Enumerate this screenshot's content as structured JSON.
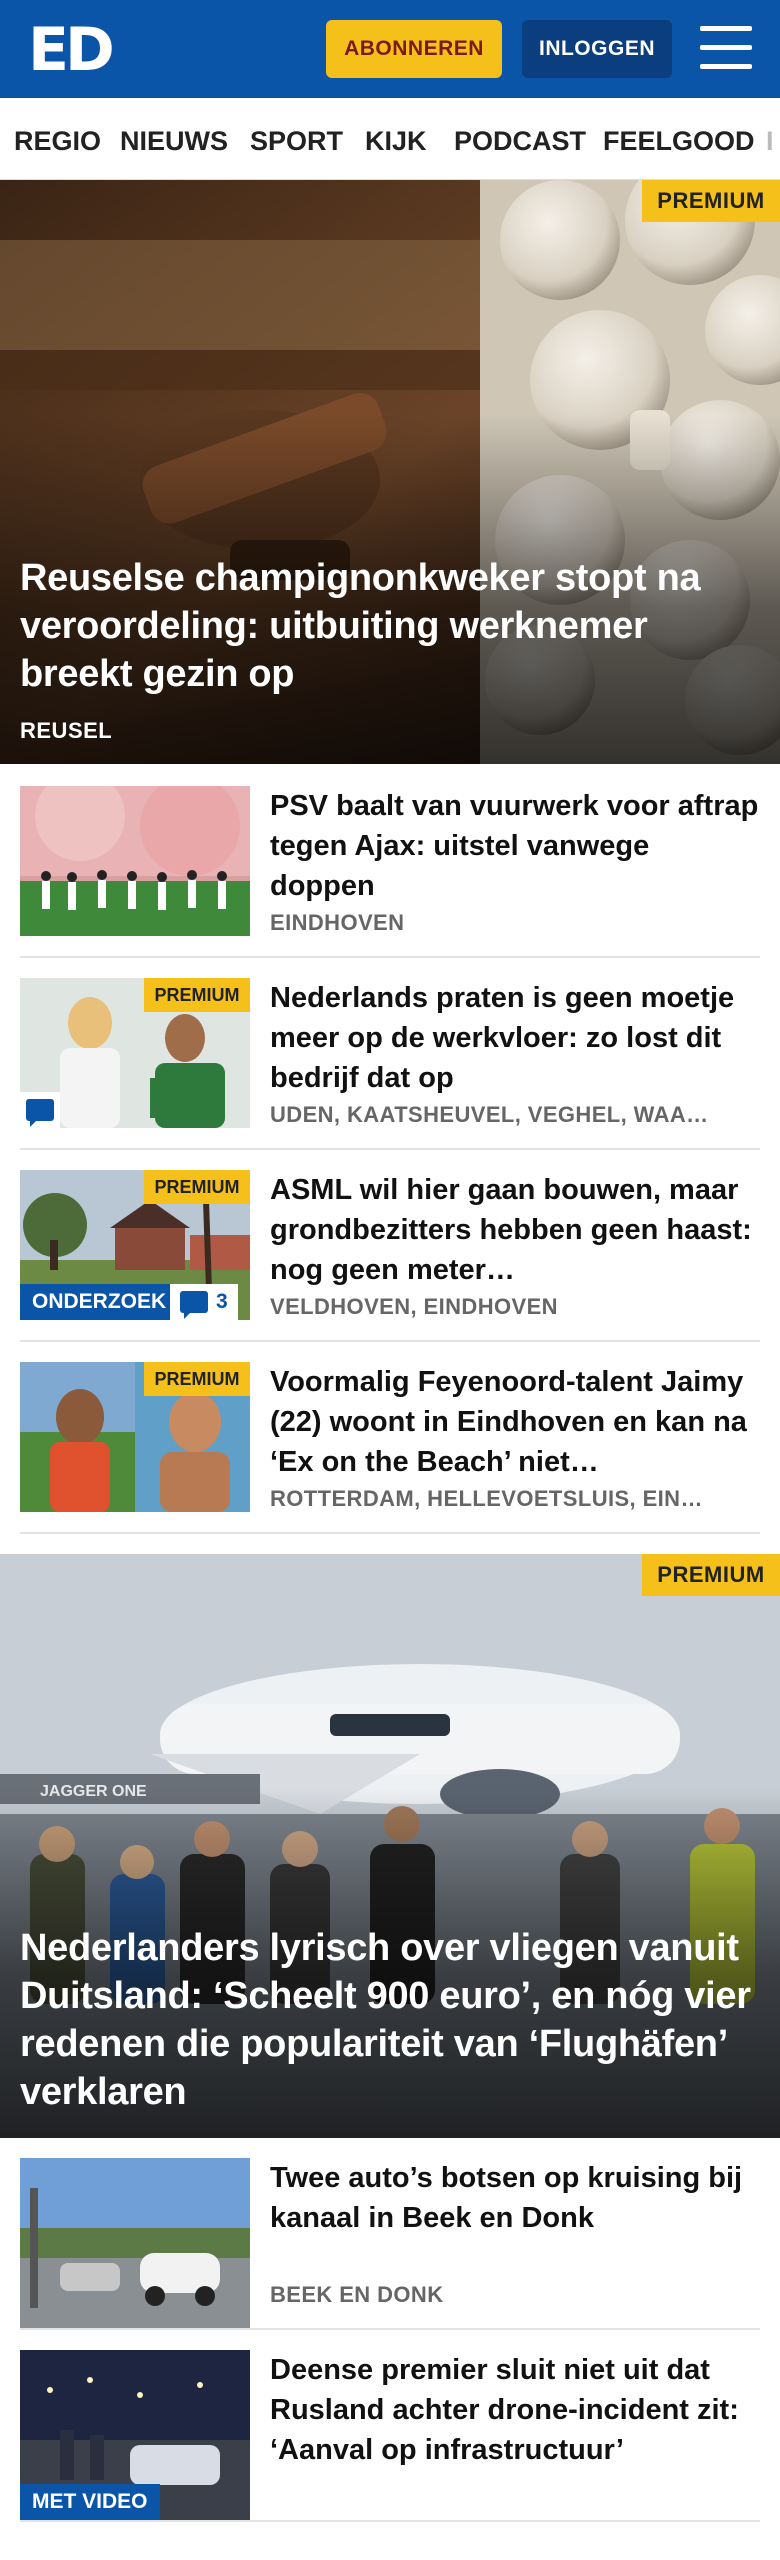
{
  "header": {
    "logo_text": "ED",
    "subscribe_label": "ABONNEREN",
    "login_label": "INLOGGEN",
    "menu_icon": "hamburger-menu-icon"
  },
  "nav": {
    "items": [
      "REGIO",
      "NIEUWS",
      "SPORT",
      "KIJK",
      "PODCAST",
      "FEELGOOD",
      "I"
    ]
  },
  "hero1": {
    "badge": "PREMIUM",
    "title": "Reuselse champignonkweker stopt na veroordeling: uitbuiting werknemer breekt gezin op",
    "location": "REUSEL"
  },
  "articles": [
    {
      "title": "PSV baalt van vuurwerk voor aftrap tegen Ajax: uitstel vanwege doppen",
      "location": "EINDHOVEN"
    },
    {
      "badge": "PREMIUM",
      "title": "Nederlands praten is geen moetje meer op de werkvloer: zo lost dit bedrijf dat op",
      "location": "UDEN, KAATSHEUVEL, VEGHEL, WAA…",
      "comment_icon": "comment-icon"
    },
    {
      "badge": "PREMIUM",
      "tag": "ONDERZOEK",
      "comments": "3",
      "title": "ASML wil hier gaan bouwen, maar grondbezitters hebben geen haast: nog geen meter…",
      "location": "VELDHOVEN, EINDHOVEN"
    },
    {
      "badge": "PREMIUM",
      "title": "Voormalig Feyenoord-talent Jaimy (22) woont in Eindhoven en kan na ‘Ex on the Beach’ niet…",
      "location": "ROTTERDAM, HELLEVOETSLUIS, EIN…"
    }
  ],
  "hero2": {
    "badge": "PREMIUM",
    "title": "Nederlanders lyrisch over vliegen vanuit Duitsland: ‘Scheelt 900 euro’, en nóg vier redenen die populariteit van ‘Flughäfen’ verklaren",
    "image_text": "JAGGER ONE"
  },
  "articles2": [
    {
      "title": "Twee auto’s botsen op kruising bij kanaal in Beek en Donk",
      "location": "BEEK EN DONK"
    },
    {
      "tag": "MET VIDEO",
      "title": "Deense premier sluit niet uit dat Rusland achter drone-incident zit: ‘Aanval op infrastructuur’"
    }
  ]
}
